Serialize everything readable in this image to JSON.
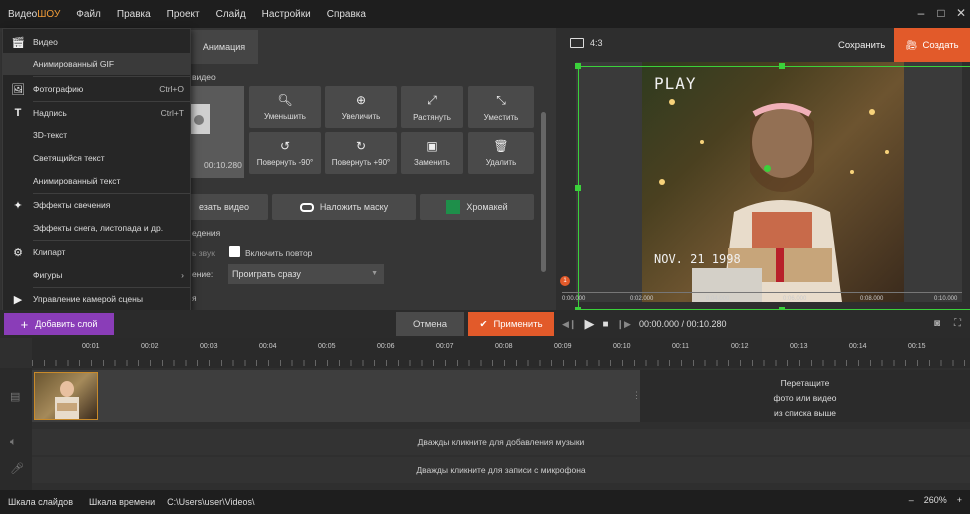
{
  "app": {
    "logo_prefix": "Видео",
    "logo_brand": "ШОУ"
  },
  "menu": [
    "Файл",
    "Правка",
    "Проект",
    "Слайд",
    "Настройки",
    "Справка"
  ],
  "editor": {
    "tab_animation": "Анимация",
    "section_video": "видео",
    "thumb_duration": "00:10.280",
    "tools": {
      "zoom_out": "Уменьшить",
      "zoom_in": "Увеличить",
      "stretch": "Растянуть",
      "fit": "Уместить",
      "rotate_left": "Повернуть -90°",
      "rotate_right": "Повернуть +90°",
      "replace": "Заменить",
      "delete": "Удалить"
    },
    "crop_video": "езать видео",
    "apply_mask": "Наложить маску",
    "chromakey": "Хромакей",
    "section_playback": "едения",
    "sound_label": "ь звук",
    "loop_label": "Включить повтор",
    "play_label": "ение:",
    "play_value": "Проиграть сразу",
    "bottom_partial": "я"
  },
  "dropdown": [
    {
      "icon": "film-icon",
      "label": "Видео",
      "shortcut": ""
    },
    {
      "icon": "",
      "label": "Анимированный GIF",
      "shortcut": ""
    },
    {
      "icon": "image-icon",
      "label": "Фотографию",
      "shortcut": "Ctrl+O"
    },
    {
      "icon": "text-icon",
      "label": "Надпись",
      "shortcut": "Ctrl+T"
    },
    {
      "icon": "",
      "label": "3D-текст",
      "shortcut": ""
    },
    {
      "icon": "",
      "label": "Светящийся текст",
      "shortcut": ""
    },
    {
      "icon": "",
      "label": "Анимированный текст",
      "shortcut": ""
    },
    {
      "icon": "magic-wand-icon",
      "label": "Эффекты свечения",
      "shortcut": ""
    },
    {
      "icon": "",
      "label": "Эффекты снега, листопада и др.",
      "shortcut": ""
    },
    {
      "icon": "gear-icon",
      "label": "Клипарт",
      "shortcut": ""
    },
    {
      "icon": "",
      "label": "Фигуры",
      "shortcut": ""
    },
    {
      "icon": "camera-icon",
      "label": "Управление камерой сцены",
      "shortcut": ""
    }
  ],
  "preview": {
    "ratio": "4:3",
    "save": "Сохранить",
    "create": "Создать",
    "overlay_play": "PLAY",
    "overlay_date": "NOV. 21 1998",
    "marker": "1",
    "ruler": [
      "0:00.000",
      "0:02.000",
      "0:04.000",
      "0:06.000",
      "0:08.000",
      "0:10.000"
    ]
  },
  "actions": {
    "add_layer": "Добавить слой",
    "cancel": "Отмена",
    "apply": "Применить",
    "time": "00:00.000 / 00:10.280"
  },
  "timeline": {
    "ticks": [
      "00:01",
      "00:02",
      "00:03",
      "00:04",
      "00:05",
      "00:06",
      "00:07",
      "00:08",
      "00:09",
      "00:10",
      "00:11",
      "00:12",
      "00:13",
      "00:14",
      "00:15"
    ],
    "drop_line1": "Перетащите",
    "drop_line2": "фото или видео",
    "drop_line3": "из списка выше",
    "music": "Дважды кликните для добавления музыки",
    "mic": "Дважды кликните для записи с микрофона"
  },
  "status": {
    "slides": "Шкала слайдов",
    "timeline": "Шкала времени",
    "path": "C:\\Users\\user\\Videos\\",
    "zoom": "260%"
  },
  "colors": {
    "accent_orange": "#e25a2a",
    "purple": "#8a3db8",
    "selection_green": "#3bd13b",
    "chromakey_green": "#1e8f4a"
  }
}
